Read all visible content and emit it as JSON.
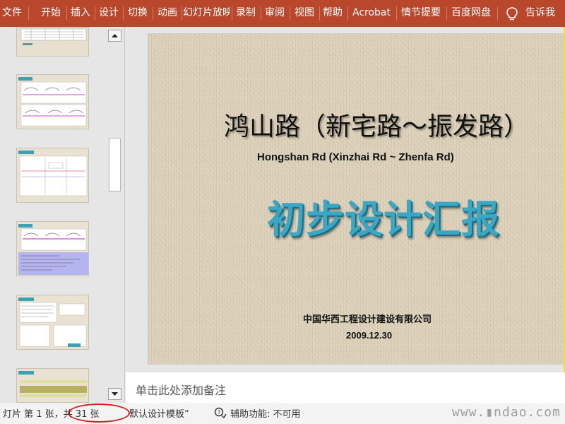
{
  "ribbon": {
    "tabs": [
      "文件",
      "开始",
      "插入",
      "设计",
      "切换",
      "动画",
      "幻灯片放映",
      "录制",
      "审阅",
      "视图",
      "帮助",
      "Acrobat",
      "情节提要",
      "百度网盘"
    ],
    "tell_me": "告诉我",
    "icon": "lightbulb-icon",
    "color": "#b9472b"
  },
  "thumbnails": {
    "count_visible": 6
  },
  "slide": {
    "title": "鸿山路（新宅路～振发路）",
    "subtitle": "Hongshan Rd  (Xinzhai Rd  ~  Zhenfa Rd)",
    "report_title": "初步设计汇报",
    "company": "中国华西工程设计建设有限公司",
    "date": "2009.12.30"
  },
  "notes": {
    "placeholder": "单击此处添加备注"
  },
  "status": {
    "slide_position": "灯片 第 1 张，共 31 张",
    "template": "默认设计模板”",
    "accessibility": "辅助功能: 不可用",
    "watermark": "www.▮ndao.com"
  }
}
